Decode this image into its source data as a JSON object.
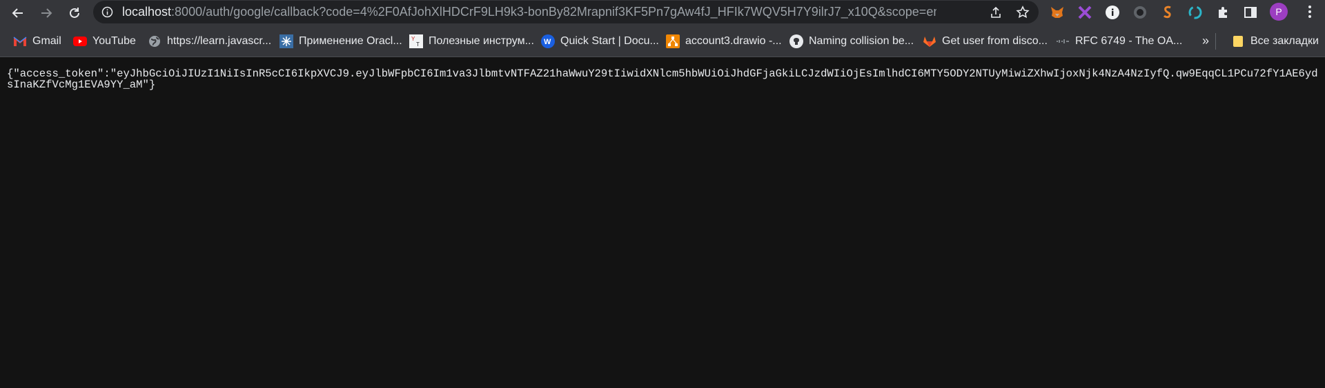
{
  "browser": {
    "address_bar": {
      "host": "localhost",
      "rest": ":8000/auth/google/callback?code=4%2F0AfJohXlHDCrF9LH9k3-bonBy82Mrapnif3KF5Pn7gAw4fJ_HFIk7WQV5H7Y9ilrJ7_x10Q&scope=email+profile+..."
    },
    "profile_initial": "P"
  },
  "bookmarks": [
    {
      "label": "Gmail",
      "icon": "gmail-icon"
    },
    {
      "label": "YouTube",
      "icon": "youtube-icon"
    },
    {
      "label": "https://learn.javascr...",
      "icon": "globe-icon"
    },
    {
      "label": "Применение Oracl...",
      "icon": "oracle-icon"
    },
    {
      "label": "Полезные инструм...",
      "icon": "tools-icon"
    },
    {
      "label": "Quick Start | Docu...",
      "icon": "w-logo-icon"
    },
    {
      "label": "account3.drawio -...",
      "icon": "drawio-icon"
    },
    {
      "label": "Naming collision be...",
      "icon": "github-icon"
    },
    {
      "label": "Get user from disco...",
      "icon": "gitlab-icon"
    },
    {
      "label": "RFC 6749 - The OA...",
      "icon": "rfc-icon"
    },
    {
      "label": "»",
      "icon": "more-bookmarks-icon"
    },
    {
      "label": "Все закладки",
      "icon": "folder-icon"
    }
  ],
  "page": {
    "json_text": "{\"access_token\":\"eyJhbGciOiJIUzI1NiIsInR5cCI6IkpXVCJ9.eyJlbWFpbCI6Im1va3JlbmtvNTFAZ21haWwuY29tIiwidXNlcm5hbWUiOiJhdGFjaGkiLCJzdWIiOjEsImlhdCI6MTY5ODY2NTUyMiwiZXhwIjoxNjk4NzA4NzIyfQ.qw9EqqCL1PCu72fY1AE6ydsInaKZfVcMg1EVA9YY_aM\"}"
  },
  "colors": {
    "toolbar": "#35363a",
    "omnibox": "#202124",
    "page_bg": "#131313",
    "text": "#e8eaed",
    "avatar": "#9c3ec1"
  }
}
